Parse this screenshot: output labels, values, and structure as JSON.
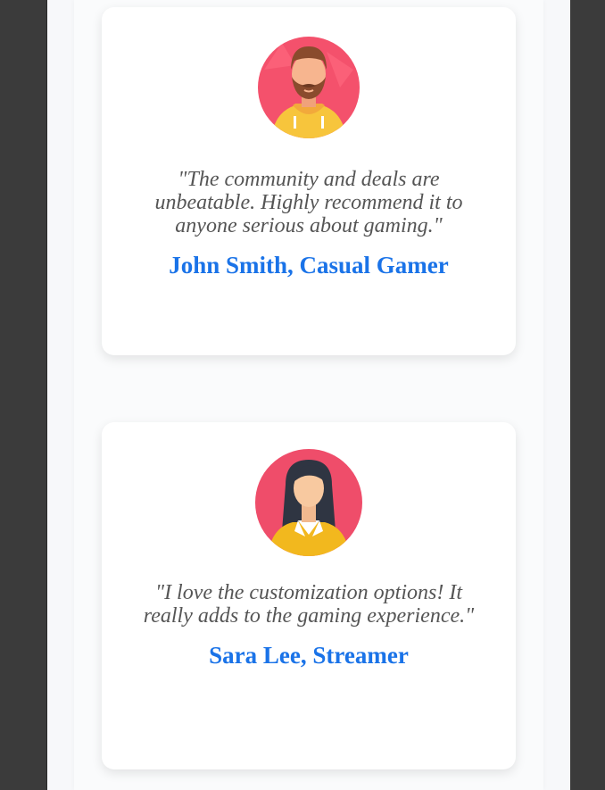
{
  "testimonials": [
    {
      "quote": "\"The community and deals are unbeatable. Highly recommend it to anyone serious about gaming.\"",
      "author": "John Smith, Casual Gamer",
      "avatar_icon": "bearded-man-avatar"
    },
    {
      "quote": "\"I love the customization options! It really adds to the gaming experience.\"",
      "author": "Sara Lee, Streamer",
      "avatar_icon": "woman-avatar"
    }
  ],
  "colors": {
    "author_link": "#1a73e8",
    "quote_text": "#555555",
    "card_bg": "#ffffff",
    "outer_bg": "#3b3b3b"
  }
}
